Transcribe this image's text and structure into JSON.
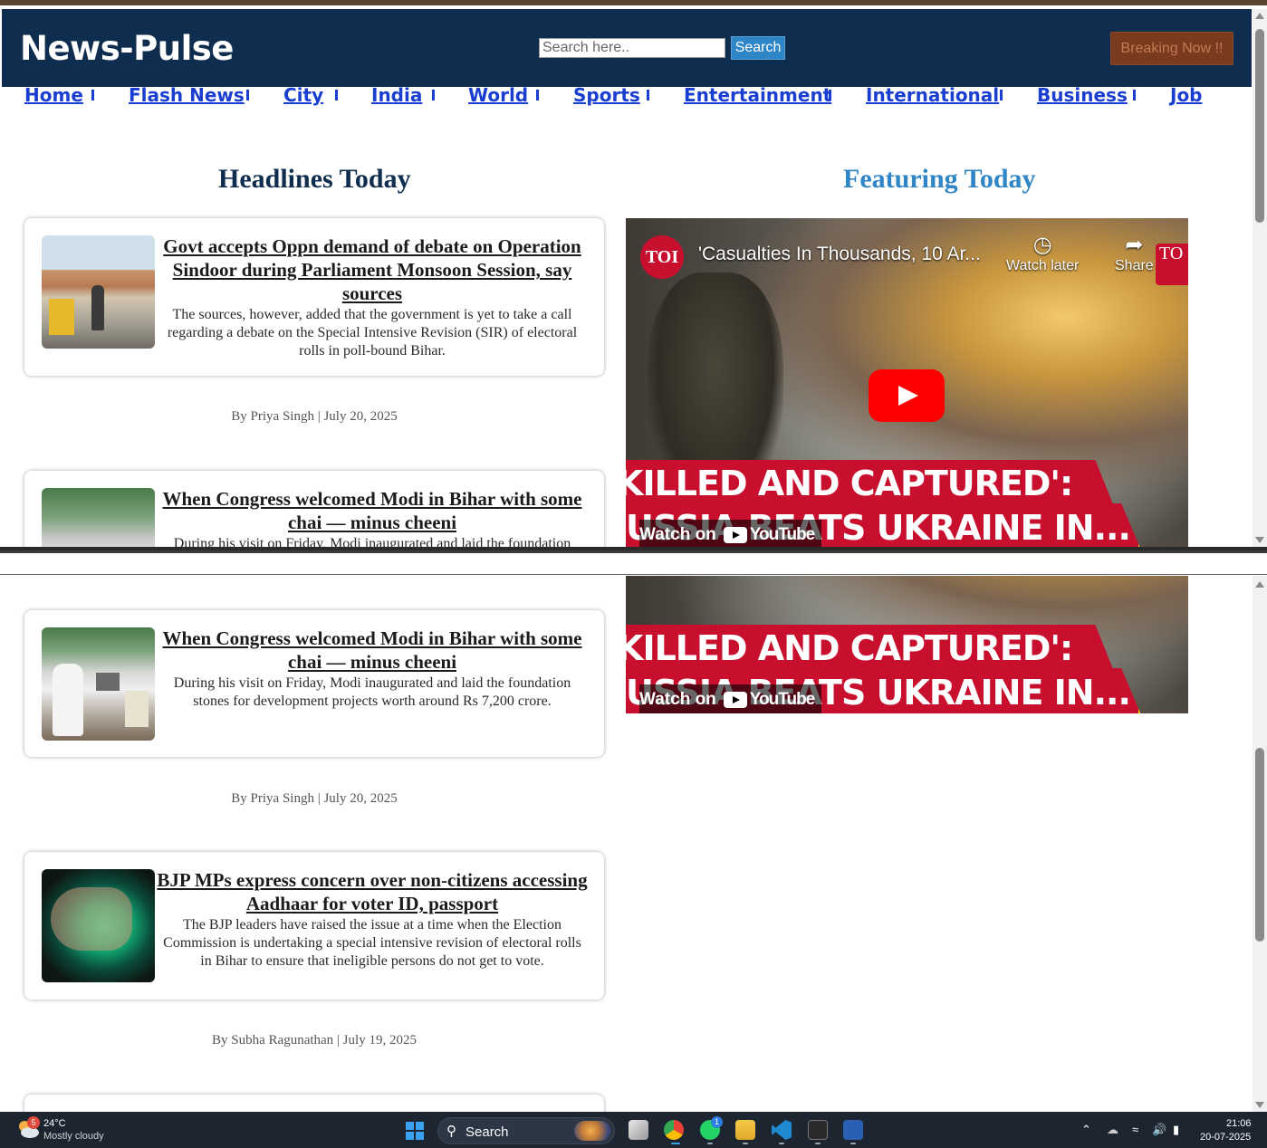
{
  "site": {
    "logo": "News-Pulse",
    "search_placeholder": "Search here..",
    "search_button": "Search",
    "breaking_button": "Breaking Now !!"
  },
  "nav": [
    "Home",
    "Flash News",
    "City",
    "India",
    "World",
    "Sports",
    "Entertainment",
    "International",
    "Business",
    "Job"
  ],
  "sections": {
    "headlines_title": "Headlines Today",
    "featuring_title": "Featuring Today"
  },
  "articles": [
    {
      "title": "Govt accepts Oppn demand of debate on Operation Sindoor during Parliament Monsoon Session, say sources",
      "description": "The sources, however, added that the government is yet to take a call regarding a debate on the Special Intensive Revision (SIR) of electoral rolls in poll-bound Bihar.",
      "byline": "By Priya Singh | July 20, 2025"
    },
    {
      "title": "When Congress welcomed Modi in Bihar with some chai — minus cheeni",
      "description": "During his visit on Friday, Modi inaugurated and laid the foundation stones for development projects worth around Rs 7,200 crore.",
      "byline": "By Priya Singh | July 20, 2025"
    },
    {
      "title": "BJP MPs express concern over non-citizens accessing Aadhaar for voter ID, passport",
      "description": "The BJP leaders have raised the issue at a time when the Election Commission is undertaking a special intensive revision of electoral rolls in Bihar to ensure that ineligible persons do not get to vote.",
      "byline": "By Subha Ragunathan | July 19, 2025"
    }
  ],
  "video": {
    "channel_badge": "TOI",
    "title": "'Casualties In Thousands, 10 Ar...",
    "watch_later": "Watch later",
    "share": "Share",
    "corner_badge": "TO",
    "banner_line1": "KILLED AND CAPTURED':",
    "banner_line2": "USSIA BEATS UKRAINE IN...",
    "watch_on": "Watch on",
    "youtube": "YouTube"
  },
  "taskbar": {
    "temperature": "24°C",
    "weather": "Mostly cloudy",
    "weather_badge": "5",
    "search_label": "Search",
    "whatsapp_badge": "1",
    "time": "21:06",
    "date": "20-07-2025"
  }
}
